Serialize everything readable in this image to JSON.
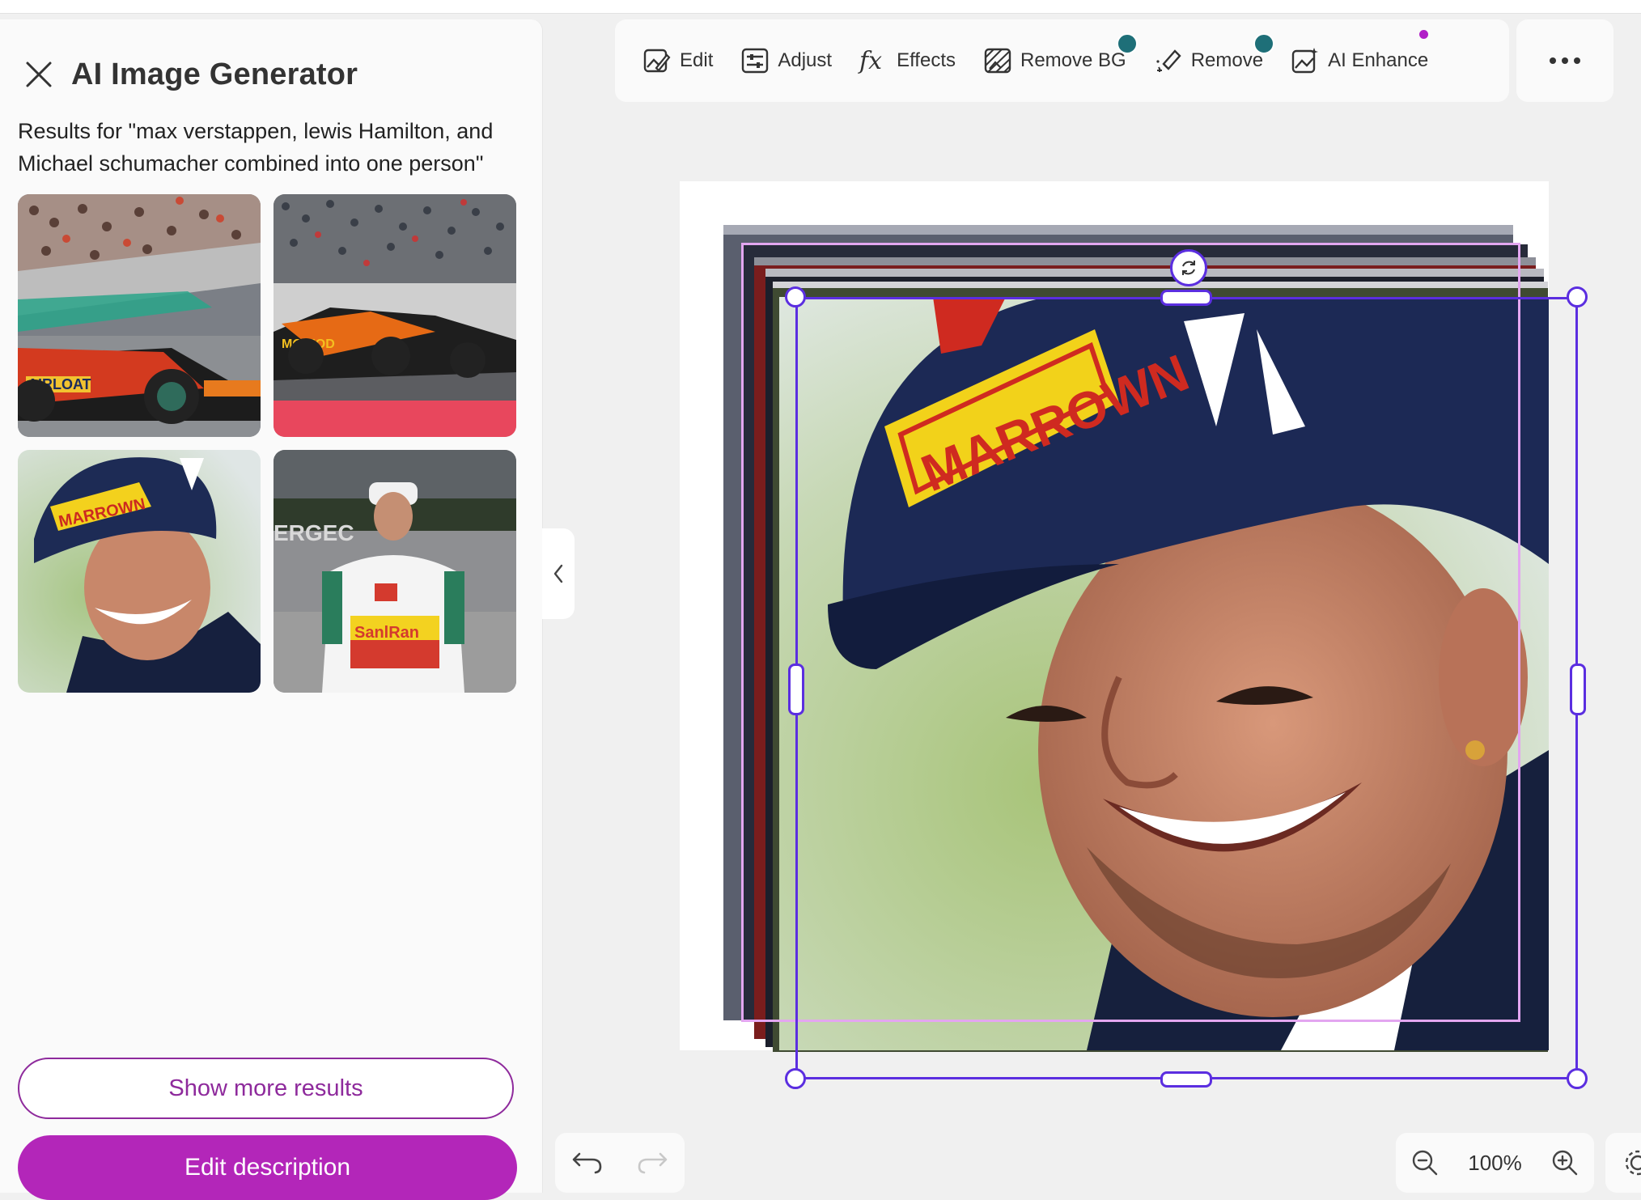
{
  "panel": {
    "title": "AI Image Generator",
    "results_text": "Results for \"max verstappen, lewis Hamilton, and Michael schumacher combined into one person\"",
    "thumbnails": [
      {
        "name": "f1-car-red-crowd"
      },
      {
        "name": "f1-car-orange-track"
      },
      {
        "name": "driver-portrait-cap"
      },
      {
        "name": "driver-standing-pitlane"
      }
    ],
    "show_more_label": "Show more results",
    "edit_description_label": "Edit description"
  },
  "toolbar": {
    "items": [
      {
        "label": "Edit",
        "icon": "edit-image-icon"
      },
      {
        "label": "Adjust",
        "icon": "adjust-sliders-icon"
      },
      {
        "label": "Effects",
        "icon": "fx-icon"
      },
      {
        "label": "Remove BG",
        "icon": "remove-bg-icon",
        "premium": true
      },
      {
        "label": "Remove",
        "icon": "eraser-sparkle-icon",
        "premium": true
      },
      {
        "label": "AI Enhance",
        "icon": "ai-enhance-icon",
        "new_dot": true
      }
    ],
    "more_icon": "more-horizontal-icon"
  },
  "canvas": {
    "cap_text_main": "MARROWN",
    "zoom": "100%"
  },
  "colors": {
    "accent_purple": "#b326b9",
    "selection": "#5b2ee0",
    "premium_badge": "#1e6f78"
  }
}
